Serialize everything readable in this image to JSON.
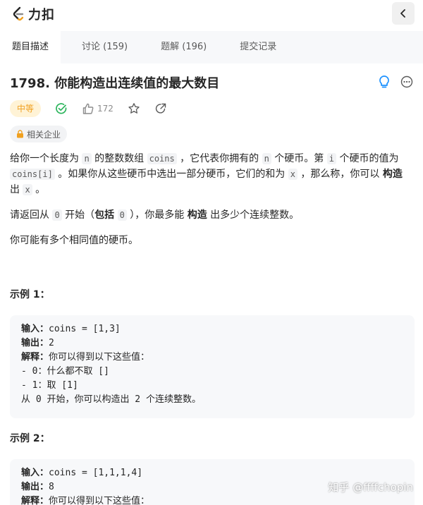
{
  "header": {
    "logo_text": "力扣"
  },
  "tabs": [
    {
      "label": "题目描述"
    },
    {
      "label": "讨论 (159)"
    },
    {
      "label": "题解 (196)"
    },
    {
      "label": "提交记录"
    }
  ],
  "problem": {
    "title": "1798. 你能构造出连续值的最大数目",
    "difficulty": "中等",
    "likes": "172",
    "company_tag": "相关企业"
  },
  "description": {
    "p1": {
      "t1": "给你一个长度为 ",
      "c1": "n",
      "t2": " 的整数数组 ",
      "c2": "coins",
      "t3": " ，它代表你拥有的 ",
      "c3": "n",
      "t4": " 个硬币。第 ",
      "c4": "i",
      "t5": " 个硬币的值为 ",
      "c5": "coins[i]",
      "t6": " 。如果你从这些硬币中选出一部分硬币，它们的和为 ",
      "c6": "x",
      "t7": " ，那么称，你可以 ",
      "b1": "构造",
      "t8": " 出 ",
      "c7": "x",
      "t9": " 。"
    },
    "p2": {
      "t1": "请返回从 ",
      "c1": "0",
      "t2": " 开始（",
      "b1": "包括",
      "t3": " ",
      "c2": "0",
      "t4": " ），你最多能 ",
      "b2": "构造",
      "t5": " 出多少个连续整数。"
    },
    "p3": "你可能有多个相同值的硬币。"
  },
  "examples": [
    {
      "title": "示例 1：",
      "input_label": "输入：",
      "input": "coins = [1,3]",
      "output_label": "输出：",
      "output": "2",
      "explain_label": "解释：",
      "explain": "你可以得到以下这些值：",
      "lines": [
        "- 0：什么都不取 []",
        "- 1：取 [1]",
        "从 0 开始，你可以构造出 2 个连续整数。"
      ]
    },
    {
      "title": "示例 2：",
      "input_label": "输入：",
      "input": "coins = [1,1,1,4]",
      "output_label": "输出：",
      "output": "8",
      "explain_label": "解释：",
      "explain": "你可以得到以下这些值："
    }
  ],
  "watermark": "知乎 @ffffchopin",
  "colors": {
    "accent": "#2db55d",
    "medium": "#f0a020",
    "hint": "#1a90ff"
  }
}
